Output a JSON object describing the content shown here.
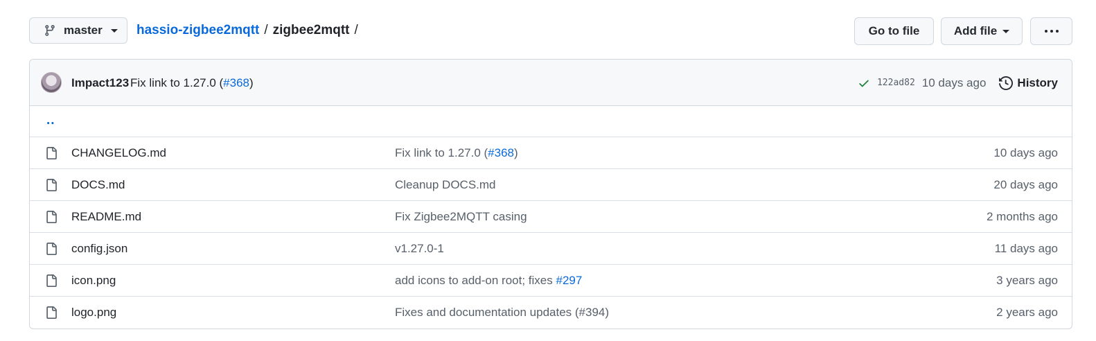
{
  "branch": {
    "name": "master"
  },
  "breadcrumb": {
    "repo": "hassio-zigbee2mqtt",
    "separator": "/",
    "folder": "zigbee2mqtt",
    "trailing": "/"
  },
  "buttons": {
    "go_to_file": "Go to file",
    "add_file": "Add file"
  },
  "commit": {
    "author": "Impact123",
    "message_prefix": "Fix link to 1.27.0 (",
    "pr": "#368",
    "message_suffix": ")",
    "sha": "122ad82",
    "age": "10 days ago",
    "history_label": "History",
    "status_color": "#1a7f37"
  },
  "parent_link": "..",
  "files": [
    {
      "name": "CHANGELOG.md",
      "msg_prefix": "Fix link to 1.27.0 (",
      "msg_link": "#368",
      "msg_suffix": ")",
      "age": "10 days ago"
    },
    {
      "name": "DOCS.md",
      "msg_prefix": "Cleanup DOCS.md",
      "msg_link": "",
      "msg_suffix": "",
      "age": "20 days ago"
    },
    {
      "name": "README.md",
      "msg_prefix": "Fix Zigbee2MQTT casing",
      "msg_link": "",
      "msg_suffix": "",
      "age": "2 months ago"
    },
    {
      "name": "config.json",
      "msg_prefix": "v1.27.0-1",
      "msg_link": "",
      "msg_suffix": "",
      "age": "11 days ago"
    },
    {
      "name": "icon.png",
      "msg_prefix": "add icons to add-on root; fixes ",
      "msg_link": "#297",
      "msg_suffix": "",
      "age": "3 years ago"
    },
    {
      "name": "logo.png",
      "msg_prefix": "Fixes and documentation updates (#394)",
      "msg_link": "",
      "msg_suffix": "",
      "age": "2 years ago"
    }
  ],
  "icons": {
    "branch": "git-branch-icon",
    "file": "file-icon",
    "check": "check-icon",
    "history": "history-icon",
    "more": "kebab-horizontal-icon"
  },
  "colors": {
    "link": "#0969da",
    "muted": "#57606a",
    "border": "#d0d7de",
    "bar_bg": "#f6f8fa"
  }
}
